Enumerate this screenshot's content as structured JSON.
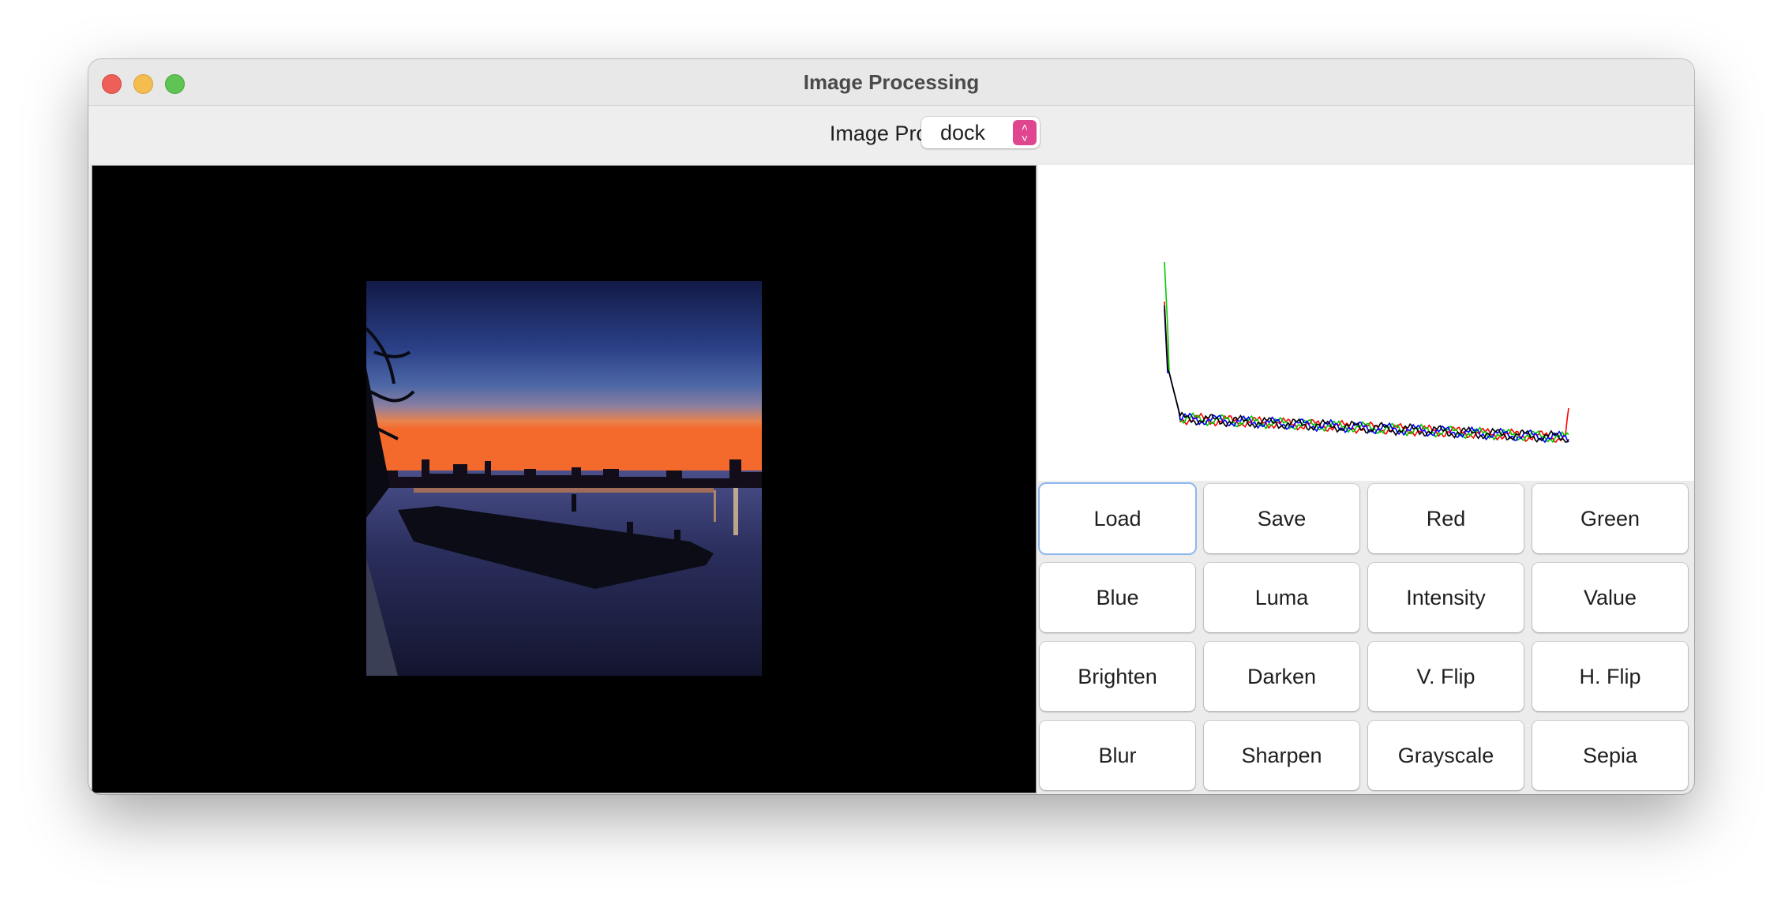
{
  "window": {
    "title": "Image Processing"
  },
  "toolbar": {
    "label": "Image Processing",
    "image_select": {
      "value": "dock"
    }
  },
  "image_view": {
    "content": "sunset dock silhouette over river with city skyline"
  },
  "histogram": {
    "chart_data": {
      "type": "line",
      "series": [
        {
          "color": "#ff0000"
        },
        {
          "color": "#00cc00"
        },
        {
          "color": "#0000ff"
        },
        {
          "color": "#000000"
        }
      ]
    }
  },
  "buttons": [
    {
      "id": "load",
      "label": "Load",
      "focused": true
    },
    {
      "id": "save",
      "label": "Save"
    },
    {
      "id": "red",
      "label": "Red"
    },
    {
      "id": "green",
      "label": "Green"
    },
    {
      "id": "blue",
      "label": "Blue"
    },
    {
      "id": "luma",
      "label": "Luma"
    },
    {
      "id": "intensity",
      "label": "Intensity"
    },
    {
      "id": "value",
      "label": "Value"
    },
    {
      "id": "brighten",
      "label": "Brighten"
    },
    {
      "id": "darken",
      "label": "Darken"
    },
    {
      "id": "vflip",
      "label": "V. Flip"
    },
    {
      "id": "hflip",
      "label": "H. Flip"
    },
    {
      "id": "blur",
      "label": "Blur"
    },
    {
      "id": "sharpen",
      "label": "Sharpen"
    },
    {
      "id": "grayscale",
      "label": "Grayscale"
    },
    {
      "id": "sepia",
      "label": "Sepia"
    }
  ]
}
